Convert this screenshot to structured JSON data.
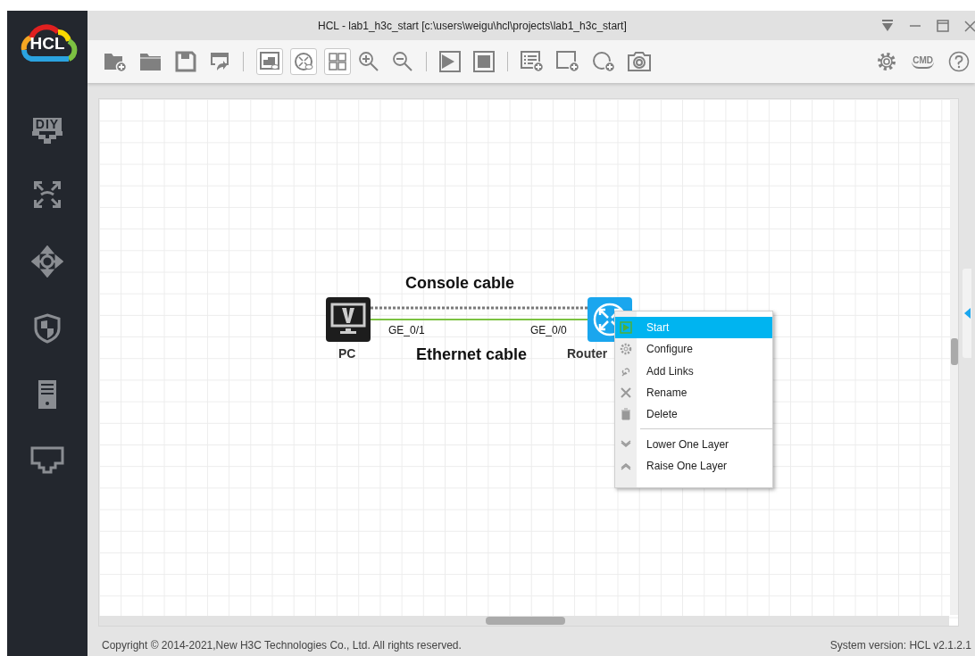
{
  "window": {
    "title": "HCL - lab1_h3c_start [c:\\users\\weigu\\hcl\\projects\\lab1_h3c_start]"
  },
  "logo": "HCL",
  "sidebar": {
    "diy_label": "DIY"
  },
  "toolbar": {
    "view_toggles": [
      {
        "on": true
      },
      {
        "on": true
      },
      {
        "on": true
      }
    ],
    "cmd_label": "CMD"
  },
  "canvas": {
    "devices": [
      {
        "kind": "pc",
        "label": "PC"
      },
      {
        "kind": "router",
        "label": "Router"
      }
    ],
    "links": [
      {
        "kind": "console",
        "label": "Console cable"
      },
      {
        "kind": "ethernet",
        "label": "Ethernet cable",
        "ports": [
          "GE_0/1",
          "GE_0/0"
        ]
      }
    ]
  },
  "context_menu": {
    "sections": [
      {
        "items": [
          {
            "label": "Start",
            "selected": true
          },
          {
            "label": "Configure",
            "selected": false
          },
          {
            "label": "Add Links",
            "selected": false
          },
          {
            "label": "Rename",
            "selected": false
          },
          {
            "label": "Delete",
            "selected": false
          }
        ]
      },
      {
        "items": [
          {
            "label": "Lower One Layer",
            "selected": false
          },
          {
            "label": "Raise One Layer",
            "selected": false
          }
        ]
      }
    ]
  },
  "status_bar": {
    "copyright": "Copyright © 2014-2021,New H3C Technologies Co., Ltd. All rights reserved.",
    "version": "System version: HCL v2.1.2.1"
  }
}
